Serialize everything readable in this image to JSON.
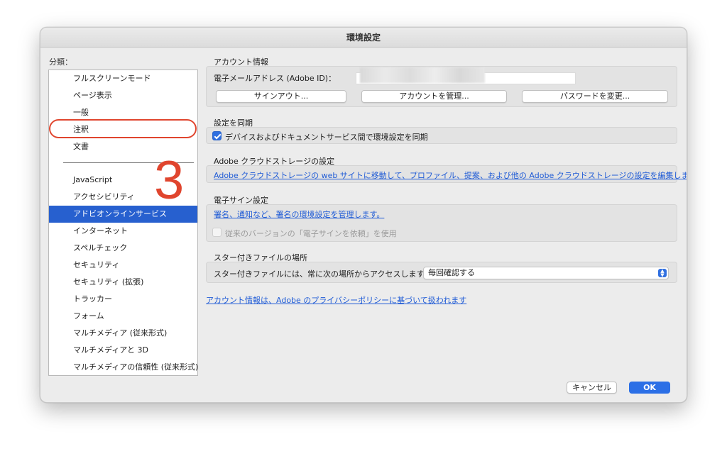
{
  "window": {
    "title": "環境設定"
  },
  "categories": {
    "label": "分類：",
    "items": [
      {
        "label": "フルスクリーンモード",
        "selected": false
      },
      {
        "label": "ページ表示",
        "selected": false
      },
      {
        "label": "一般",
        "selected": false
      },
      {
        "label": "注釈",
        "selected": false,
        "highlighted": true
      },
      {
        "label": "文書",
        "selected": false
      },
      {
        "label": "JavaScript",
        "selected": false
      },
      {
        "label": "アクセシビリティ",
        "selected": false
      },
      {
        "label": "アドビオンラインサービス",
        "selected": true
      },
      {
        "label": "インターネット",
        "selected": false
      },
      {
        "label": "スペルチェック",
        "selected": false
      },
      {
        "label": "セキュリティ",
        "selected": false
      },
      {
        "label": "セキュリティ (拡張)",
        "selected": false
      },
      {
        "label": "トラッカー",
        "selected": false
      },
      {
        "label": "フォーム",
        "selected": false
      },
      {
        "label": "マルチメディア (従来形式)",
        "selected": false
      },
      {
        "label": "マルチメディアと 3D",
        "selected": false
      },
      {
        "label": "マルチメディアの信頼性 (従来形式)",
        "selected": false
      }
    ],
    "annotation_number": "3",
    "annotation_color": "#e0452e",
    "selected_color": "#2760cf"
  },
  "account": {
    "title": "アカウント情報",
    "email_label": "電子メールアドレス (Adobe ID)：",
    "sign_out": "サインアウト...",
    "manage_account": "アカウントを管理...",
    "change_password": "パスワードを変更..."
  },
  "sync": {
    "title": "設定を同期",
    "checkbox_label": "デバイスおよびドキュメントサービス間で環境設定を同期",
    "checked": true
  },
  "cloud": {
    "title": "Adobe クラウドストレージの設定",
    "link": "Adobe クラウドストレージの web サイトに移動して、プロファイル、提案、および他の Adobe クラウドストレージの設定を編集します。"
  },
  "esign": {
    "title": "電子サイン設定",
    "link": "署名、通知など、署名の環境設定を管理します。",
    "legacy_checkbox_label": "従来のバージョンの「電子サインを依頼」を使用",
    "legacy_checked": false
  },
  "starred": {
    "title": "スター付きファイルの場所",
    "label": "スター付きファイルには、常に次の場所からアクセスします...",
    "selected_option": "毎回確認する"
  },
  "privacy_link": "アカウント情報は、Adobe のプライバシーポリシーに基づいて扱われます",
  "footer": {
    "cancel": "キャンセル",
    "ok": "OK",
    "ok_color": "#2b6fe6"
  }
}
